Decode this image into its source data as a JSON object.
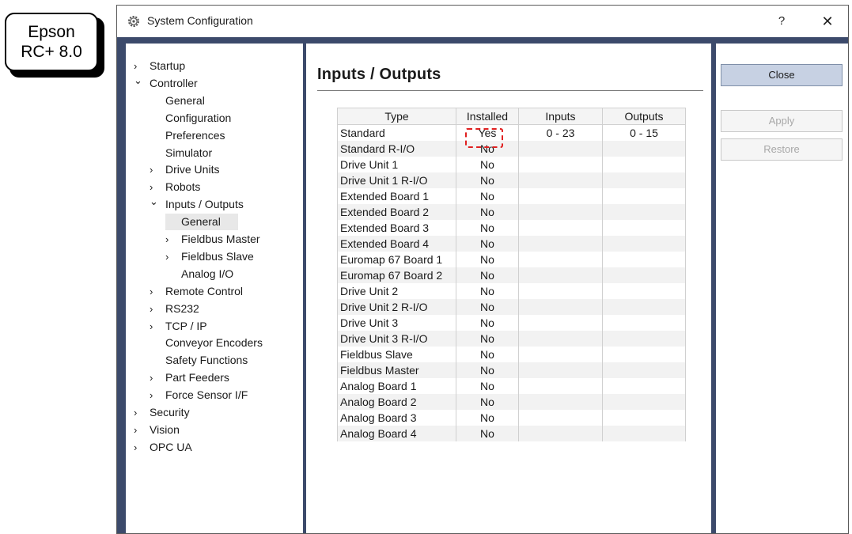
{
  "badge": {
    "line1": "Epson",
    "line2": "RC+ 8.0"
  },
  "window": {
    "title": "System Configuration",
    "help": "?",
    "close": "✕"
  },
  "tree": [
    {
      "label": "Startup",
      "chevron": "›"
    },
    {
      "label": "Controller",
      "chevron": "⌄"
    },
    {
      "label": "General",
      "chevron": ""
    },
    {
      "label": "Configuration",
      "chevron": ""
    },
    {
      "label": "Preferences",
      "chevron": ""
    },
    {
      "label": "Simulator",
      "chevron": ""
    },
    {
      "label": "Drive Units",
      "chevron": "›"
    },
    {
      "label": "Robots",
      "chevron": "›"
    },
    {
      "label": "Inputs / Outputs",
      "chevron": "⌄"
    },
    {
      "label": "General",
      "chevron": ""
    },
    {
      "label": "Fieldbus Master",
      "chevron": "›"
    },
    {
      "label": "Fieldbus Slave",
      "chevron": "›"
    },
    {
      "label": "Analog I/O",
      "chevron": ""
    },
    {
      "label": "Remote Control",
      "chevron": "›"
    },
    {
      "label": "RS232",
      "chevron": "›"
    },
    {
      "label": "TCP / IP",
      "chevron": "›"
    },
    {
      "label": "Conveyor Encoders",
      "chevron": ""
    },
    {
      "label": "Safety Functions",
      "chevron": ""
    },
    {
      "label": "Part Feeders",
      "chevron": "›"
    },
    {
      "label": "Force Sensor I/F",
      "chevron": "›"
    },
    {
      "label": "Security",
      "chevron": "›"
    },
    {
      "label": "Vision",
      "chevron": "›"
    },
    {
      "label": "OPC UA",
      "chevron": "›"
    }
  ],
  "main": {
    "heading": "Inputs / Outputs",
    "columns": [
      "Type",
      "Installed",
      "Inputs",
      "Outputs"
    ],
    "rows": [
      [
        "Standard",
        "Yes",
        "0 - 23",
        "0 - 15"
      ],
      [
        "Standard R-I/O",
        "No",
        "",
        ""
      ],
      [
        "Drive Unit 1",
        "No",
        "",
        ""
      ],
      [
        "Drive Unit 1 R-I/O",
        "No",
        "",
        ""
      ],
      [
        "Extended Board 1",
        "No",
        "",
        ""
      ],
      [
        "Extended Board 2",
        "No",
        "",
        ""
      ],
      [
        "Extended Board 3",
        "No",
        "",
        ""
      ],
      [
        "Extended Board 4",
        "No",
        "",
        ""
      ],
      [
        "Euromap 67 Board 1",
        "No",
        "",
        ""
      ],
      [
        "Euromap 67 Board 2",
        "No",
        "",
        ""
      ],
      [
        "Drive Unit 2",
        "No",
        "",
        ""
      ],
      [
        "Drive Unit 2 R-I/O",
        "No",
        "",
        ""
      ],
      [
        "Drive Unit 3",
        "No",
        "",
        ""
      ],
      [
        "Drive Unit 3 R-I/O",
        "No",
        "",
        ""
      ],
      [
        "Fieldbus Slave",
        "No",
        "",
        ""
      ],
      [
        "Fieldbus Master",
        "No",
        "",
        ""
      ],
      [
        "Analog Board 1",
        "No",
        "",
        ""
      ],
      [
        "Analog Board 2",
        "No",
        "",
        ""
      ],
      [
        "Analog Board 3",
        "No",
        "",
        ""
      ],
      [
        "Analog Board 4",
        "No",
        "",
        ""
      ]
    ]
  },
  "buttons": {
    "close": "Close",
    "apply": "Apply",
    "restore": "Restore"
  },
  "colors": {
    "frame": "#3c4a6b",
    "primary_button": "#c7d1e3",
    "highlight": "#e02020"
  }
}
